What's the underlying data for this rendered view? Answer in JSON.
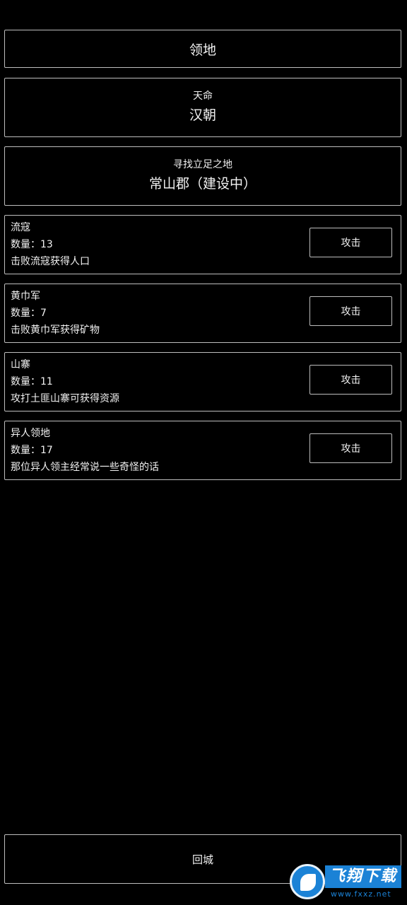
{
  "header": {
    "title": "领地"
  },
  "tianming": {
    "label": "天命",
    "value": "汉朝"
  },
  "territory": {
    "label": "寻找立足之地",
    "value": "常山郡（建设中）"
  },
  "enemies": [
    {
      "name": "流寇",
      "count": "数量：13",
      "desc": "击败流寇获得人口",
      "action": "攻击"
    },
    {
      "name": "黄巾军",
      "count": "数量：7",
      "desc": "击败黄巾军获得矿物",
      "action": "攻击"
    },
    {
      "name": "山寨",
      "count": "数量：11",
      "desc": "攻打土匪山寨可获得资源",
      "action": "攻击"
    },
    {
      "name": "异人领地",
      "count": "数量：17",
      "desc": "那位异人领主经常说一些奇怪的话",
      "action": "攻击"
    }
  ],
  "footer": {
    "return_label": "回城"
  },
  "watermark": {
    "brand": "飞翔下载",
    "url": "www.fxxz.net",
    "color": "#1b82d6"
  }
}
